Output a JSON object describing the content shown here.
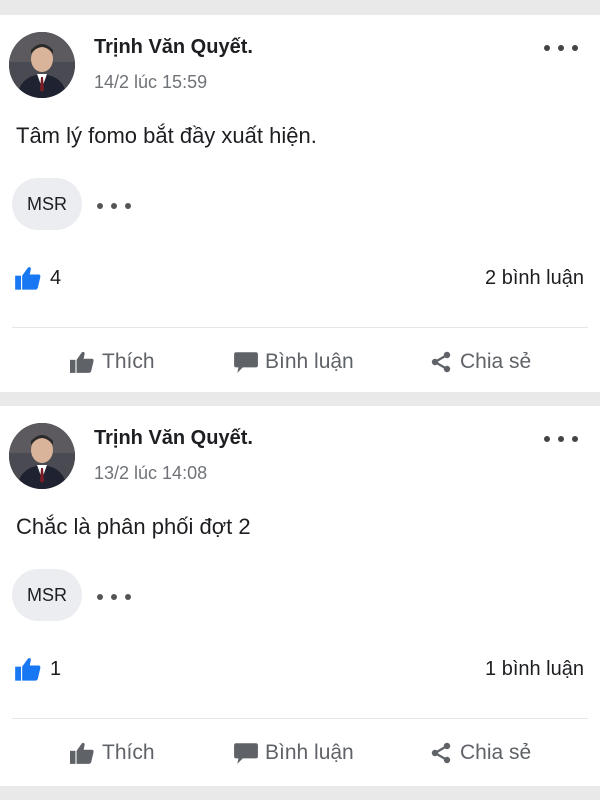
{
  "posts": [
    {
      "author": "Trịnh Văn Quyết.",
      "time": "14/2 lúc 15:59",
      "content": "Tâm lý fomo bắt đầy xuất hiện.",
      "tag": "MSR",
      "like_count": "4",
      "comment_count": "2 bình luận"
    },
    {
      "author": "Trịnh Văn Quyết.",
      "time": "13/2 lúc 14:08",
      "content": "Chắc là phân phối đợt 2",
      "tag": "MSR",
      "like_count": "1",
      "comment_count": "1 bình luận"
    }
  ],
  "actions": {
    "like_label": "Thích",
    "comment_label": "Bình luận",
    "share_label": "Chia sẻ"
  },
  "colors": {
    "like_blue": "#1877f2",
    "action_gray": "#5f6368",
    "separator": "#e9e9e9"
  }
}
